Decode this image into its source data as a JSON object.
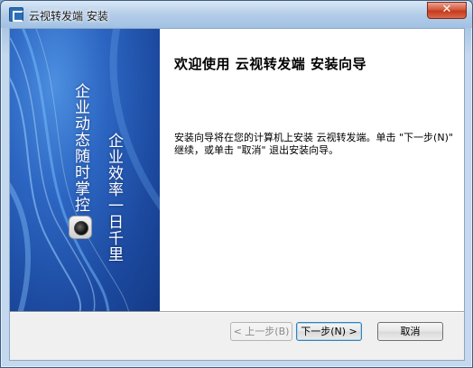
{
  "window": {
    "title": "云视转发端 安装",
    "close_label": "✕"
  },
  "banner": {
    "slogan_line_1": "企业动态随时掌控",
    "slogan_line_2": "企业效率一日千里"
  },
  "content": {
    "heading": "欢迎使用 云视转发端 安装向导",
    "description": "安装向导将在您的计算机上安装 云视转发端。单击 \"下一步(N)\" 继续，或单击 \"取消\" 退出安装向导。"
  },
  "buttons": {
    "back_label": "< 上一步(B)",
    "next_label": "下一步(N) >",
    "cancel_label": "取消"
  },
  "colors": {
    "banner_blue": "#1c4aa0",
    "accent_border": "#3c7fb1"
  }
}
